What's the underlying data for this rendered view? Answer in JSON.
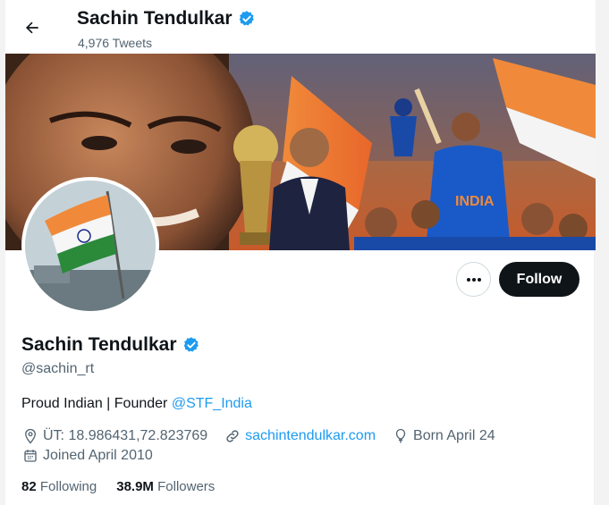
{
  "header": {
    "name": "Sachin Tendulkar",
    "tweet_count": "4,976 Tweets"
  },
  "banner": {
    "jersey_text": "INDIA"
  },
  "actions": {
    "more_label": "•••",
    "follow_label": "Follow"
  },
  "profile": {
    "name": "Sachin Tendulkar",
    "handle": "@sachin_rt",
    "bio_text": "Proud Indian | Founder ",
    "bio_link": "@STF_India",
    "location": "ÜT: 18.986431,72.823769",
    "website": "sachintendulkar.com",
    "born": "Born April 24",
    "joined": "Joined April 2010",
    "following_count": "82",
    "following_label": "Following",
    "followers_count": "38.9M",
    "followers_label": "Followers"
  },
  "icons": {
    "back": "arrow-left-icon",
    "verified": "verified-badge-icon",
    "more": "more-dots-icon",
    "location": "location-pin-icon",
    "link": "link-icon",
    "birthday": "balloon-icon",
    "calendar": "calendar-icon"
  },
  "colors": {
    "accent": "#1d9bf0",
    "text_primary": "#0f1419",
    "text_secondary": "#536471",
    "follow_bg": "#0f1419"
  }
}
